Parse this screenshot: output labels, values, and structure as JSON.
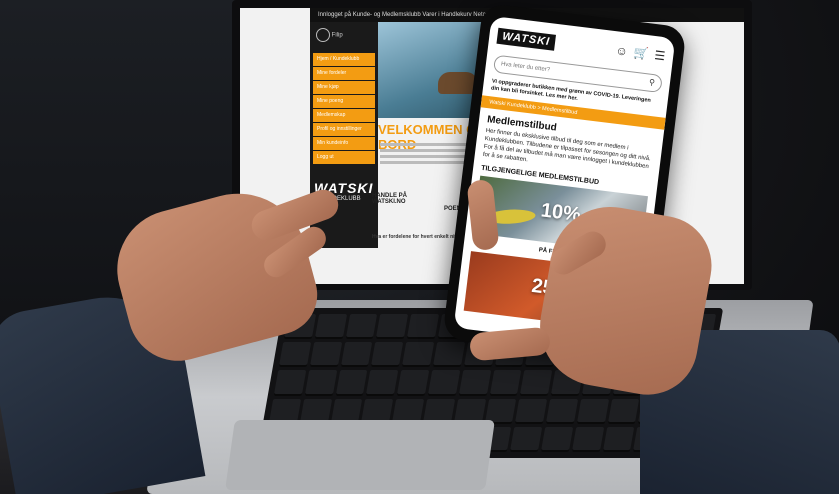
{
  "laptop_site": {
    "topbar_text": "Innlogget på Kunde- og Medlemsklubb   Varer i Handlekurv   Netcom AS",
    "user_label": "Filip",
    "menu_items": [
      "Hjem / Kundeklubb",
      "Mine fordeler",
      "Mine kjøp",
      "Mine poeng",
      "Medlemskap",
      "Profil og innstillinger",
      "Min kundeinfo",
      "Logg ut"
    ],
    "logo": "WATSKI",
    "logo_sub": "KUNDEKLUBB",
    "welcome": "VELKOMMEN OM BORD",
    "step1": "HANDLE PÅ WATSKI.NO",
    "step2": "POENG",
    "faq": "Hva er fordelene for hvert enkelt nivå?"
  },
  "phone_site": {
    "logo": "WATSKI",
    "search_placeholder": "Hva leter du etter?",
    "notice": "Vi oppgraderer butikken med grønn av COVID-19. Leveringen din kan bli forsinket. Les mer her.",
    "breadcrumb": "Watski Kundeklubb  >  Medlemstilbud",
    "title": "Medlemstilbud",
    "text": "Her finner du eksklusive tilbud til deg som er medlem i Kundeklubben. Tilbudene er tilpasset for sesongen og ditt nivå. For å få del av tilbudet må man være innlogget i kundeklubben for å se rabatten.",
    "subtitle": "TILGJENGELIGE MEDLEMSTILBUD",
    "offer1_pct": "10%",
    "offer1_cta": "PÅ FENDER",
    "offer2_pct": "25%"
  },
  "icons": [
    "user-icon",
    "cart-icon",
    "menu-icon",
    "search-icon"
  ],
  "colors": {
    "accent": "#f39c12",
    "dark": "#111111"
  }
}
